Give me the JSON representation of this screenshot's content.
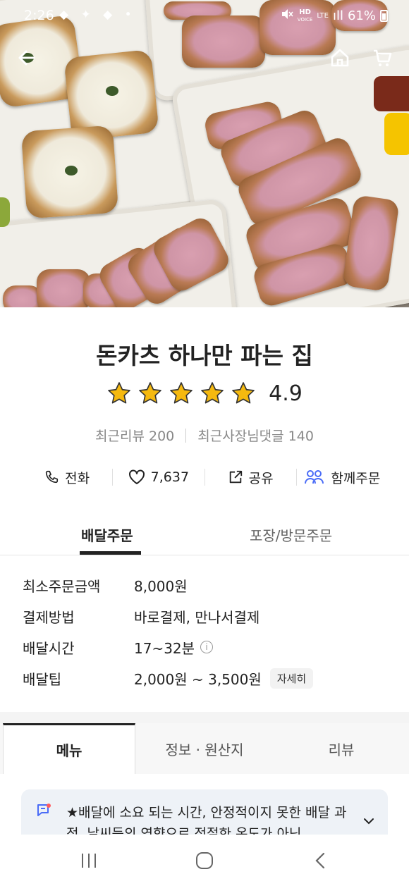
{
  "status_bar": {
    "time": "2:26",
    "notification_icons": "◆ ✦ ◆ •",
    "network": "HD",
    "network_sub": "VOICE",
    "lte": "LTE",
    "signal": "ıll",
    "battery": "61%"
  },
  "header": {
    "back_icon": "arrow-left-icon",
    "home_icon": "home-icon",
    "cart_icon": "cart-icon"
  },
  "store": {
    "name": "돈카츠 하나만 파는 집",
    "rating": 4.9,
    "rating_text": "4.9",
    "stars_filled": 5,
    "recent_reviews": "최근리뷰 200",
    "recent_owner_comments": "최근사장님댓글 140"
  },
  "actions": [
    {
      "label": "전화",
      "icon": "phone-icon"
    },
    {
      "label": "7,637",
      "icon": "heart-icon"
    },
    {
      "label": "공유",
      "icon": "share-icon"
    },
    {
      "label": "함께주문",
      "icon": "group-icon"
    }
  ],
  "order_tabs": {
    "delivery": "배달주문",
    "pickup": "포장/방문주문",
    "selected": "delivery"
  },
  "info": {
    "min_order_label": "최소주문금액",
    "min_order_value": "8,000원",
    "payment_label": "결제방법",
    "payment_value": "바로결제, 만나서결제",
    "delivery_time_label": "배달시간",
    "delivery_time_value": "17~32분",
    "tip_label": "배달팁",
    "tip_value": "2,000원 ~ 3,500원",
    "detail_button": "자세히"
  },
  "menu_tabs": {
    "menu": "메뉴",
    "info": "정보 · 원산지",
    "review": "리뷰",
    "selected": "menu"
  },
  "notice": {
    "text": "★배달에 소요 되는 시간, 안정적이지 못한 배달 과정, 날씨등의 영향으로 적절한 온도가 아닌"
  },
  "colors": {
    "star": "#F5B90F",
    "accent_group": "#4A6CF7",
    "notice_bg": "#EEF2F7",
    "notice_icon": "#4A6CF7"
  }
}
